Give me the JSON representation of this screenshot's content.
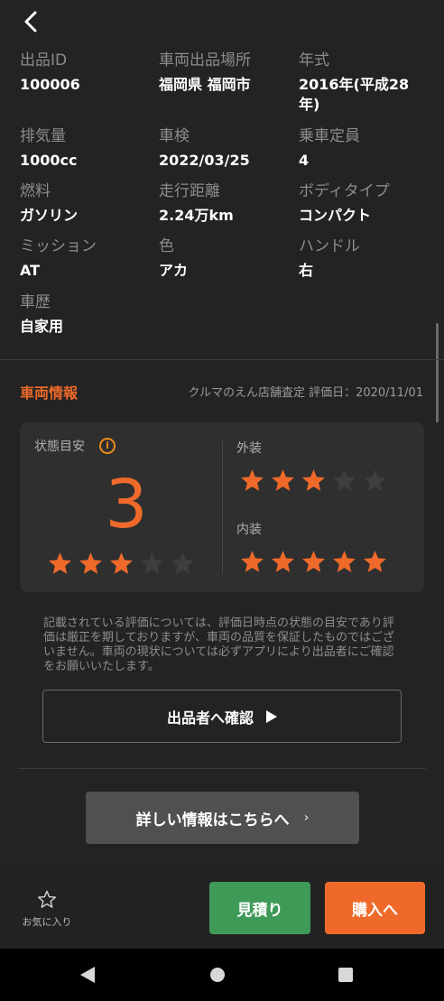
{
  "header": {
    "back_icon": "chevron-left-icon"
  },
  "specs": [
    {
      "label": "出品ID",
      "value": "100006"
    },
    {
      "label": "車両出品場所",
      "value": "福岡県 福岡市"
    },
    {
      "label": "年式",
      "value": "2016年(平成28年)"
    },
    {
      "label": "排気量",
      "value": "1000cc"
    },
    {
      "label": "車検",
      "value": "2022/03/25"
    },
    {
      "label": "乗車定員",
      "value": "4"
    },
    {
      "label": "燃料",
      "value": "ガソリン"
    },
    {
      "label": "走行距離",
      "value": "2.24万km"
    },
    {
      "label": "ボディタイプ",
      "value": "コンパクト"
    },
    {
      "label": "ミッション",
      "value": "AT"
    },
    {
      "label": "色",
      "value": "アカ"
    },
    {
      "label": "ハンドル",
      "value": "右"
    },
    {
      "label": "車歴",
      "value": "自家用"
    }
  ],
  "vehicle_info": {
    "title": "車両情報",
    "meta": "クルマのえん店舗査定 評価日：2020/11/01",
    "condition": {
      "label": "状態目安",
      "score": "3",
      "stars": 3,
      "max_stars": 5
    },
    "exterior": {
      "label": "外装",
      "stars": 3,
      "max_stars": 5
    },
    "interior": {
      "label": "内装",
      "stars": 5,
      "max_stars": 5
    }
  },
  "disclaimer": "記載されている評価については、評価日時点の状態の目安であり評価は厳正を期しておりますが、車両の品質を保証したものではございません。車両の現状については必ずアプリにより出品者にご確認をお願いいたします。",
  "buttons": {
    "confirm": "出品者へ確認",
    "detail": "詳しい情報はこちらへ",
    "favorite": "お気に入り",
    "quote": "見積り",
    "buy": "購入へ"
  },
  "colors": {
    "accent": "#ef6a2a",
    "star_on": "#ef6a2a",
    "star_off": "#3e3e3e",
    "quote": "#3f9a58",
    "background": "#232323"
  }
}
